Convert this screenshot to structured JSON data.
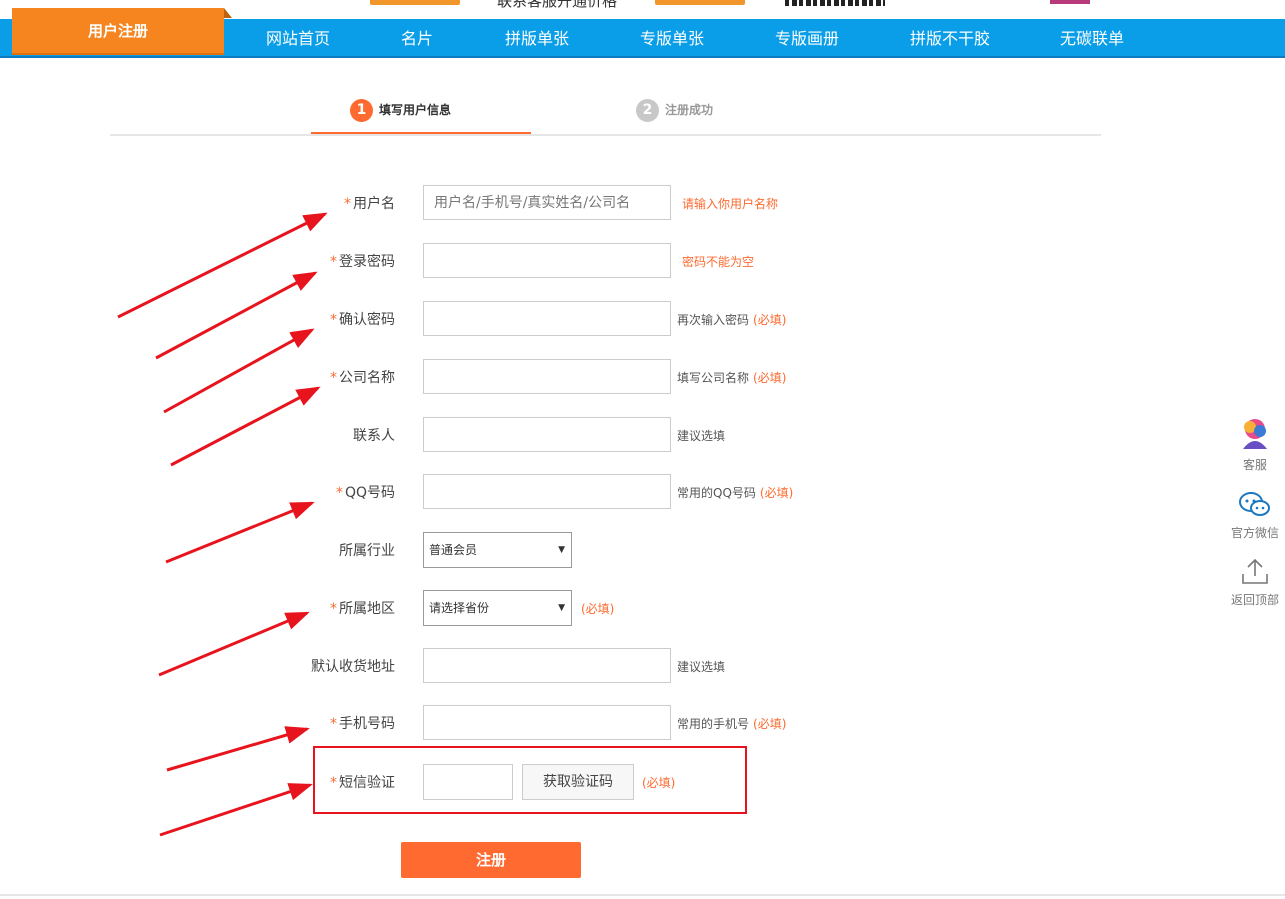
{
  "top_strip": {
    "contact_text": "联系客服开通价格"
  },
  "nav": {
    "active_tab": "用户注册",
    "items": [
      "网站首页",
      "名片",
      "拼版单张",
      "专版单张",
      "专版画册",
      "拼版不干胶",
      "无碳联单"
    ]
  },
  "steps": [
    {
      "num": "1",
      "label": "填写用户信息"
    },
    {
      "num": "2",
      "label": "注册成功"
    }
  ],
  "form": {
    "username": {
      "label": "用户名",
      "placeholder": "用户名/手机号/真实姓名/公司名",
      "hint": "请输入你用户名称"
    },
    "password": {
      "label": "登录密码",
      "hint": "密码不能为空"
    },
    "confirm": {
      "label": "确认密码",
      "hint": "再次输入密码",
      "req": "(必填)"
    },
    "company": {
      "label": "公司名称",
      "hint": "填写公司名称",
      "req": "(必填)"
    },
    "contact": {
      "label": "联系人",
      "hint": "建议选填"
    },
    "qq": {
      "label": "QQ号码",
      "hint": "常用的QQ号码",
      "req": "(必填)"
    },
    "industry": {
      "label": "所属行业",
      "value": "普通会员"
    },
    "region": {
      "label": "所属地区",
      "value": "请选择省份",
      "req": "(必填)"
    },
    "address": {
      "label": "默认收货地址",
      "hint": "建议选填"
    },
    "mobile": {
      "label": "手机号码",
      "hint": "常用的手机号",
      "req": "(必填)"
    },
    "sms": {
      "label": "短信验证",
      "button": "获取验证码",
      "req": "(必填)"
    },
    "required_mark": "*",
    "submit": "注册"
  },
  "side": {
    "service": "客服",
    "wechat": "官方微信",
    "top": "返回顶部"
  },
  "colors": {
    "accent": "#fe6a2f",
    "nav": "#0a9ee8",
    "active_tab": "#f6851f",
    "annotation": "#e8141d"
  }
}
